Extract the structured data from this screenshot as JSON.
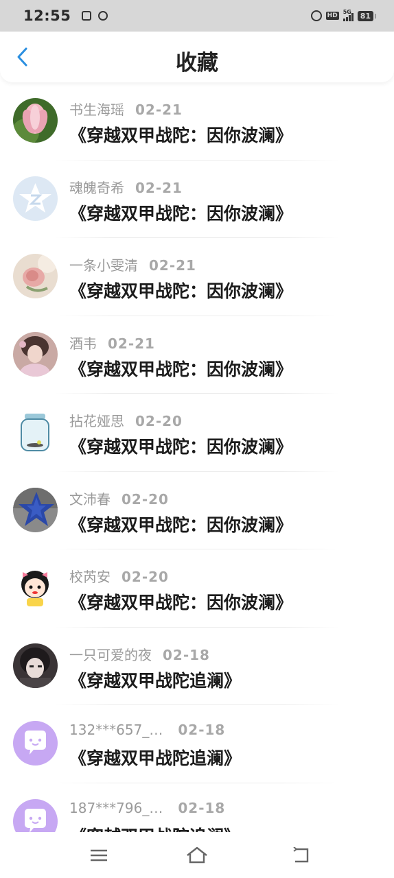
{
  "status_bar": {
    "time": "12:55",
    "network": "5G",
    "hd": "HD",
    "battery": "81"
  },
  "header": {
    "title": "收藏"
  },
  "favorites": [
    {
      "nickname": "书生海瑶",
      "date": "02-21",
      "title": "《穿越双甲战陀：因你波澜》",
      "avatar": "lotus"
    },
    {
      "nickname": "魂魄奇希",
      "date": "02-21",
      "title": "《穿越双甲战陀：因你波澜》",
      "avatar": "qq-default"
    },
    {
      "nickname": "一条小雯清",
      "date": "02-21",
      "title": "《穿越双甲战陀：因你波澜》",
      "avatar": "rose"
    },
    {
      "nickname": "酒韦",
      "date": "02-21",
      "title": "《穿越双甲战陀：因你波澜》",
      "avatar": "portrait-girl"
    },
    {
      "nickname": "拈花娅思",
      "date": "02-20",
      "title": "《穿越双甲战陀：因你波澜》",
      "avatar": "jar"
    },
    {
      "nickname": "文沛春",
      "date": "02-20",
      "title": "《穿越双甲战陀：因你波澜》",
      "avatar": "blue-star"
    },
    {
      "nickname": "校芮安",
      "date": "02-20",
      "title": "《穿越双甲战陀：因你波澜》",
      "avatar": "cartoon-girl"
    },
    {
      "nickname": "一只可爱的夜",
      "date": "02-18",
      "title": "《穿越双甲战陀追澜》",
      "avatar": "dark-anime"
    },
    {
      "nickname": "132***657_…",
      "date": "02-18",
      "title": "《穿越双甲战陀追澜》",
      "avatar": "chat-bubble"
    },
    {
      "nickname": "187***796_…",
      "date": "02-18",
      "title": "《穿越双甲战陀追澜》",
      "avatar": "chat-bubble"
    }
  ],
  "colors": {
    "accent": "#2b8fe0",
    "avatar_purple": "#c7a8f3"
  }
}
